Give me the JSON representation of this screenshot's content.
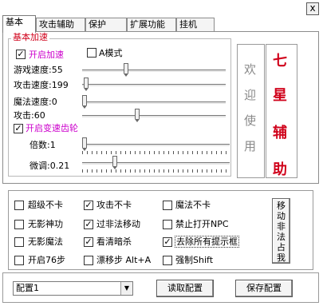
{
  "tabs": [
    "基本",
    "攻击辅助",
    "保护",
    "扩展功能",
    "挂机"
  ],
  "close_label": "x",
  "basic_group": {
    "title": "基本加速",
    "enable_accel": {
      "label": "开启加速",
      "checked": true
    },
    "a_mode": {
      "label": "A模式",
      "checked": false
    },
    "game_speed": {
      "label": "游戏速度:",
      "value": "55"
    },
    "attack_speed": {
      "label": "攻击速度:",
      "value": "199"
    },
    "magic_speed": {
      "label": "魔法速度:",
      "value": "0"
    },
    "attack": {
      "label": "攻击:",
      "value": "60"
    },
    "enable_gear": {
      "label": "开启变速齿轮",
      "checked": true
    },
    "multiplier": {
      "label": "倍数:",
      "value": "1"
    },
    "fine_tune": {
      "label": "微调:",
      "value": "0.21"
    }
  },
  "welcome_chars": [
    "欢",
    "迎",
    "使",
    "用"
  ],
  "title_chars": [
    "七",
    "星",
    "辅",
    "助"
  ],
  "options": [
    {
      "label": "超级不卡",
      "checked": false
    },
    {
      "label": "攻击不卡",
      "checked": true
    },
    {
      "label": "魔法不卡",
      "checked": false
    },
    {
      "label": "无影神功",
      "checked": false
    },
    {
      "label": "过非法移动",
      "checked": true
    },
    {
      "label": "禁止打开NPC",
      "checked": false
    },
    {
      "label": "无影魔法",
      "checked": false
    },
    {
      "label": "看清暗杀",
      "checked": true
    },
    {
      "label": "去除所有提示框",
      "checked": true
    },
    {
      "label": "开启76步",
      "checked": false
    },
    {
      "label": "漂移步 Alt+A",
      "checked": false
    },
    {
      "label": "强制Shift",
      "checked": false
    }
  ],
  "move_button_label": "移动非法占我",
  "config_select": {
    "value": "配置1"
  },
  "read_config_label": "读取配置",
  "save_config_label": "保存配置",
  "check_mark": "✓",
  "sliders": {
    "game_speed_level": 0.3,
    "attack_speed_level": 0.01,
    "magic_speed_level": 0.0,
    "attack_level": 0.38,
    "multiplier_level": 0.0,
    "fine_tune_level": 0.21
  }
}
